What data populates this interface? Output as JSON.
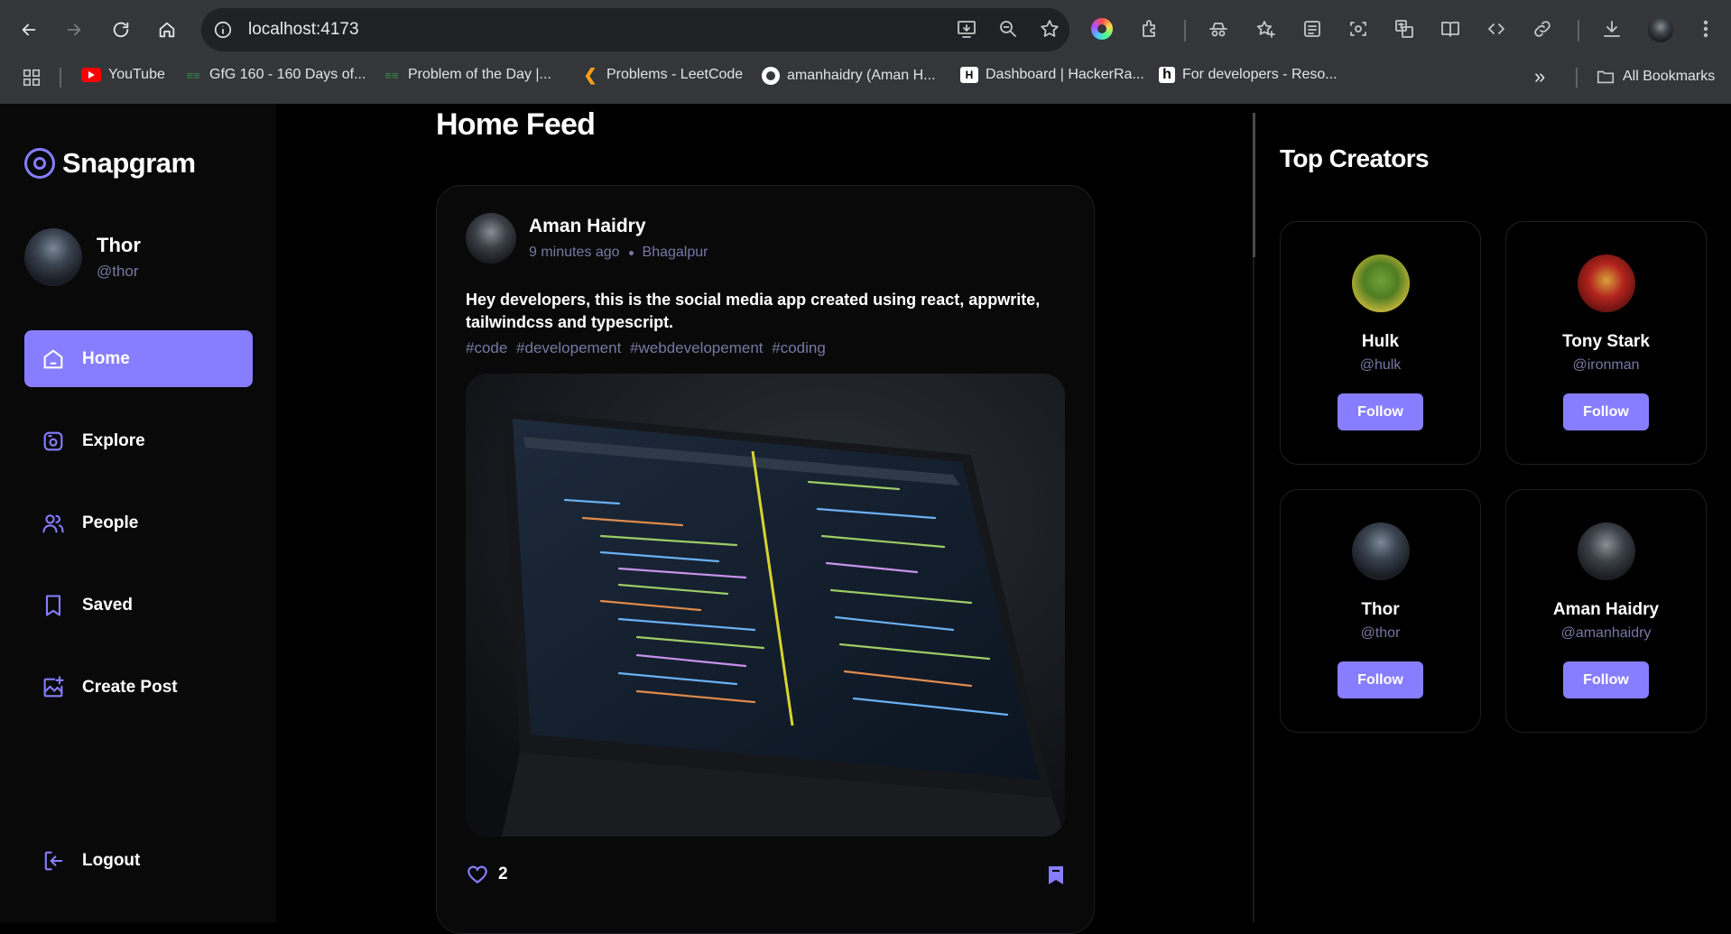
{
  "browser": {
    "url": "localhost:4173",
    "bookmarks": [
      {
        "label": "YouTube",
        "icon": "youtube-icon"
      },
      {
        "label": "GfG 160 - 160 Days of...",
        "icon": "gfg-icon"
      },
      {
        "label": "Problem of the Day |...",
        "icon": "gfg-icon"
      },
      {
        "label": "Problems - LeetCode",
        "icon": "leetcode-icon"
      },
      {
        "label": "amanhaidry (Aman H...",
        "icon": "github-icon"
      },
      {
        "label": "Dashboard | HackerRa...",
        "icon": "hackerrank-icon"
      },
      {
        "label": "For developers - Reso...",
        "icon": "resource-icon"
      }
    ],
    "all_bookmarks_label": "All Bookmarks"
  },
  "sidebar": {
    "logo": "Snapgram",
    "user": {
      "name": "Thor",
      "handle": "@thor"
    },
    "nav": [
      {
        "label": "Home",
        "icon": "home-icon",
        "active": true
      },
      {
        "label": "Explore",
        "icon": "explore-icon",
        "active": false
      },
      {
        "label": "People",
        "icon": "people-icon",
        "active": false
      },
      {
        "label": "Saved",
        "icon": "bookmark-icon",
        "active": false
      },
      {
        "label": "Create Post",
        "icon": "create-post-icon",
        "active": false
      }
    ],
    "logout_label": "Logout"
  },
  "feed": {
    "title": "Home Feed",
    "post": {
      "author": "Aman Haidry",
      "time": "9 minutes ago",
      "location": "Bhagalpur",
      "caption": "Hey developers, this is the social media app created using react, appwrite, tailwindcss and typescript.",
      "tags": [
        "#code",
        "#developement",
        "#webdevelopement",
        "#coding"
      ],
      "likes": "2"
    }
  },
  "top_creators": {
    "title": "Top Creators",
    "creators": [
      {
        "name": "Hulk",
        "handle": "@hulk",
        "follow_label": "Follow"
      },
      {
        "name": "Tony Stark",
        "handle": "@ironman",
        "follow_label": "Follow"
      },
      {
        "name": "Thor",
        "handle": "@thor",
        "follow_label": "Follow"
      },
      {
        "name": "Aman Haidry",
        "handle": "@amanhaidry",
        "follow_label": "Follow"
      }
    ]
  },
  "colors": {
    "accent": "#877eff",
    "muted": "#7878a3",
    "background": "#000000",
    "sidebar": "#09090a"
  }
}
